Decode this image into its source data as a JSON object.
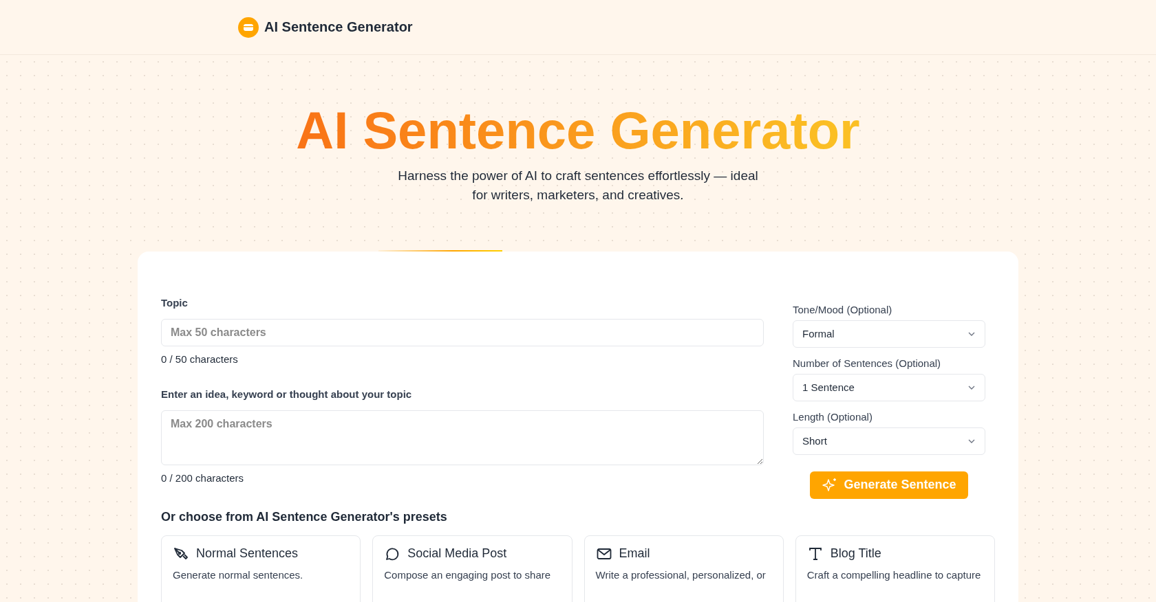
{
  "header": {
    "brand": "AI Sentence Generator"
  },
  "hero": {
    "title": "AI Sentence Generator",
    "subtitle": "Harness the power of AI to craft sentences effortlessly — ideal for writers, marketers, and creatives."
  },
  "form": {
    "topic": {
      "label": "Topic",
      "placeholder": "Max 50 characters",
      "counter": "0 / 50 characters"
    },
    "idea": {
      "label": "Enter an idea, keyword or thought about your topic",
      "placeholder": "Max 200 characters",
      "counter": "0 / 200 characters"
    },
    "selects": [
      {
        "label": "Tone/Mood (Optional)",
        "value": "Formal"
      },
      {
        "label": "Number of Sentences (Optional)",
        "value": "1 Sentence"
      },
      {
        "label": "Length (Optional)",
        "value": "Short"
      }
    ],
    "generate_button": "Generate Sentence"
  },
  "presets": {
    "heading": "Or choose from AI Sentence Generator's presets",
    "items": [
      {
        "kind": "pen",
        "title": "Normal Sentences",
        "description": "Generate normal sentences."
      },
      {
        "kind": "chat",
        "title": "Social Media Post",
        "description": "Compose an engaging post to share"
      },
      {
        "kind": "mail",
        "title": "Email",
        "description": "Write a professional, personalized, or"
      },
      {
        "kind": "type",
        "title": "Blog Title",
        "description": "Craft a compelling headline to capture"
      }
    ]
  }
}
